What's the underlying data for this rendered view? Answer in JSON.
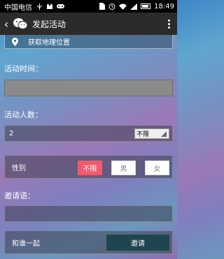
{
  "status_bar": {
    "carrier": "中国电信",
    "time": "18:49"
  },
  "header": {
    "back_icon": "chevron-left-icon",
    "title": "发起活动",
    "more_icon": "vertical-dots-icon"
  },
  "location": {
    "icon": "location-pin-icon",
    "label": "获取地理位置"
  },
  "activity_time": {
    "label": "活动时间：",
    "value": ""
  },
  "participant_count": {
    "label": "活动人数：",
    "value": "2",
    "select_value": "不限"
  },
  "gender": {
    "label": "性别",
    "options": [
      "不限",
      "男",
      "女"
    ],
    "selected": "不限",
    "active_color": "#f25a6d"
  },
  "invitation": {
    "label": "邀请语：",
    "value": ""
  },
  "companion": {
    "label": "和谁一起",
    "invite_button": "邀请"
  }
}
